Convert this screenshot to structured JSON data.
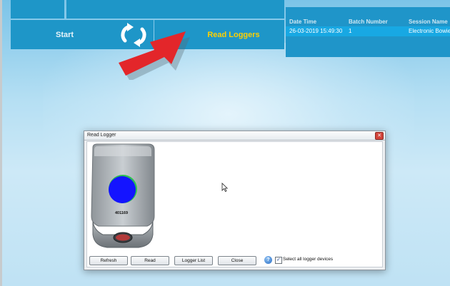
{
  "colors": {
    "accent": "#1e96c8",
    "highlight_text": "#ffd000",
    "selected_row": "#18a8e3",
    "annotation_arrow": "#e3262a"
  },
  "toolbar": {
    "start_label": "Start",
    "sync_icon": "refresh-arrows-icon",
    "read_loggers_label": "Read Loggers"
  },
  "session_grid": {
    "headers": [
      "Date Time",
      "Batch Number",
      "Session Name"
    ],
    "rows": [
      [
        "26-03-2019 15:49:30",
        "1",
        "Electronic Bowie"
      ]
    ]
  },
  "annotation": {
    "arrow_icon": "red-pointer-arrow-icon"
  },
  "read_logger_window": {
    "title": "Read Logger",
    "close_icon": "close-x-icon",
    "device_id": "401169",
    "device_brand_icon": "brand-badge-icon",
    "buttons": {
      "refresh": "Refresh",
      "read": "Read",
      "logger_list": "Logger List",
      "close": "Close"
    },
    "help_icon": "help-question-icon",
    "help_glyph": "?",
    "select_all_checked": true,
    "select_all_label": "Select all logger devices"
  }
}
